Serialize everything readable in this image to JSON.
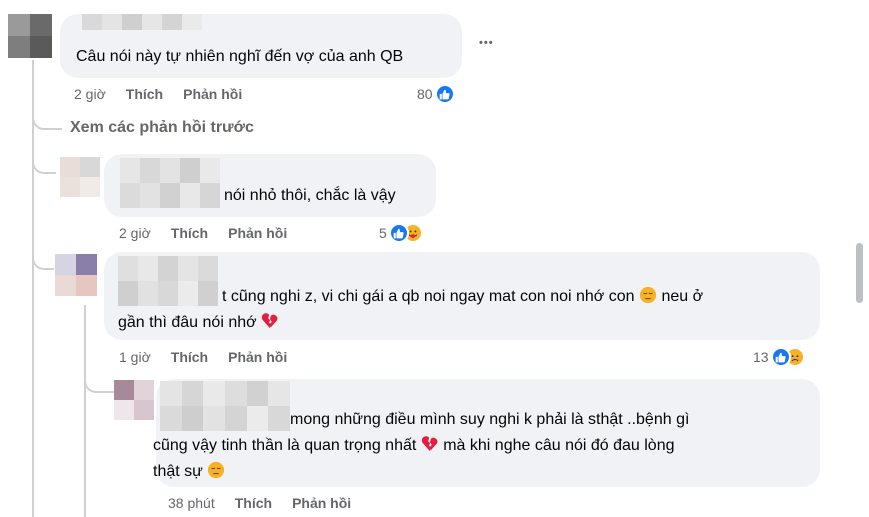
{
  "comments": [
    {
      "id": "c1",
      "text": "Câu nói này tự nhiên nghĩ đến vợ của anh QB",
      "time": "2 giờ",
      "like_label": "Thích",
      "reply_label": "Phản hồi",
      "reaction_count": "80",
      "reactions": [
        "like-icon"
      ]
    },
    {
      "id": "c2",
      "text": "nói nhỏ thôi, chắc là vậy",
      "time": "2 giờ",
      "like_label": "Thích",
      "reply_label": "Phản hồi",
      "reaction_count": "5",
      "reactions": [
        "like-icon",
        "care-icon"
      ]
    },
    {
      "id": "c3",
      "text_line1": "t cũng nghi z, vi chi gái a qb noi ngay mat con noi nhớ con",
      "text_line1_tail": "neu ở",
      "text_line2": "gần thì đâu nói nhớ",
      "time": "1 giờ",
      "like_label": "Thích",
      "reply_label": "Phản hồi",
      "reaction_count": "13",
      "reactions": [
        "like-icon",
        "sad-icon"
      ]
    },
    {
      "id": "c4",
      "text_line1": "mong những điều mình suy nghi k phải là sthật ..bệnh gì",
      "text_line2": "cũng vậy tinh thần là quan trọng nhất",
      "text_line2_tail": "mà khi nghe câu nói đó đau lòng",
      "text_line3": "thật sự",
      "time": "38 phút",
      "like_label": "Thích",
      "reply_label": "Phản hồi"
    }
  ],
  "view_previous_replies": "Xem các phản hồi trước",
  "more_options": "•••",
  "colors": {
    "bubble": "#f0f2f5",
    "meta_text": "#65676b",
    "like_blue": "#1877f2",
    "emoji_yellow": "#f7b125",
    "broken_heart": "#e41e3f"
  }
}
